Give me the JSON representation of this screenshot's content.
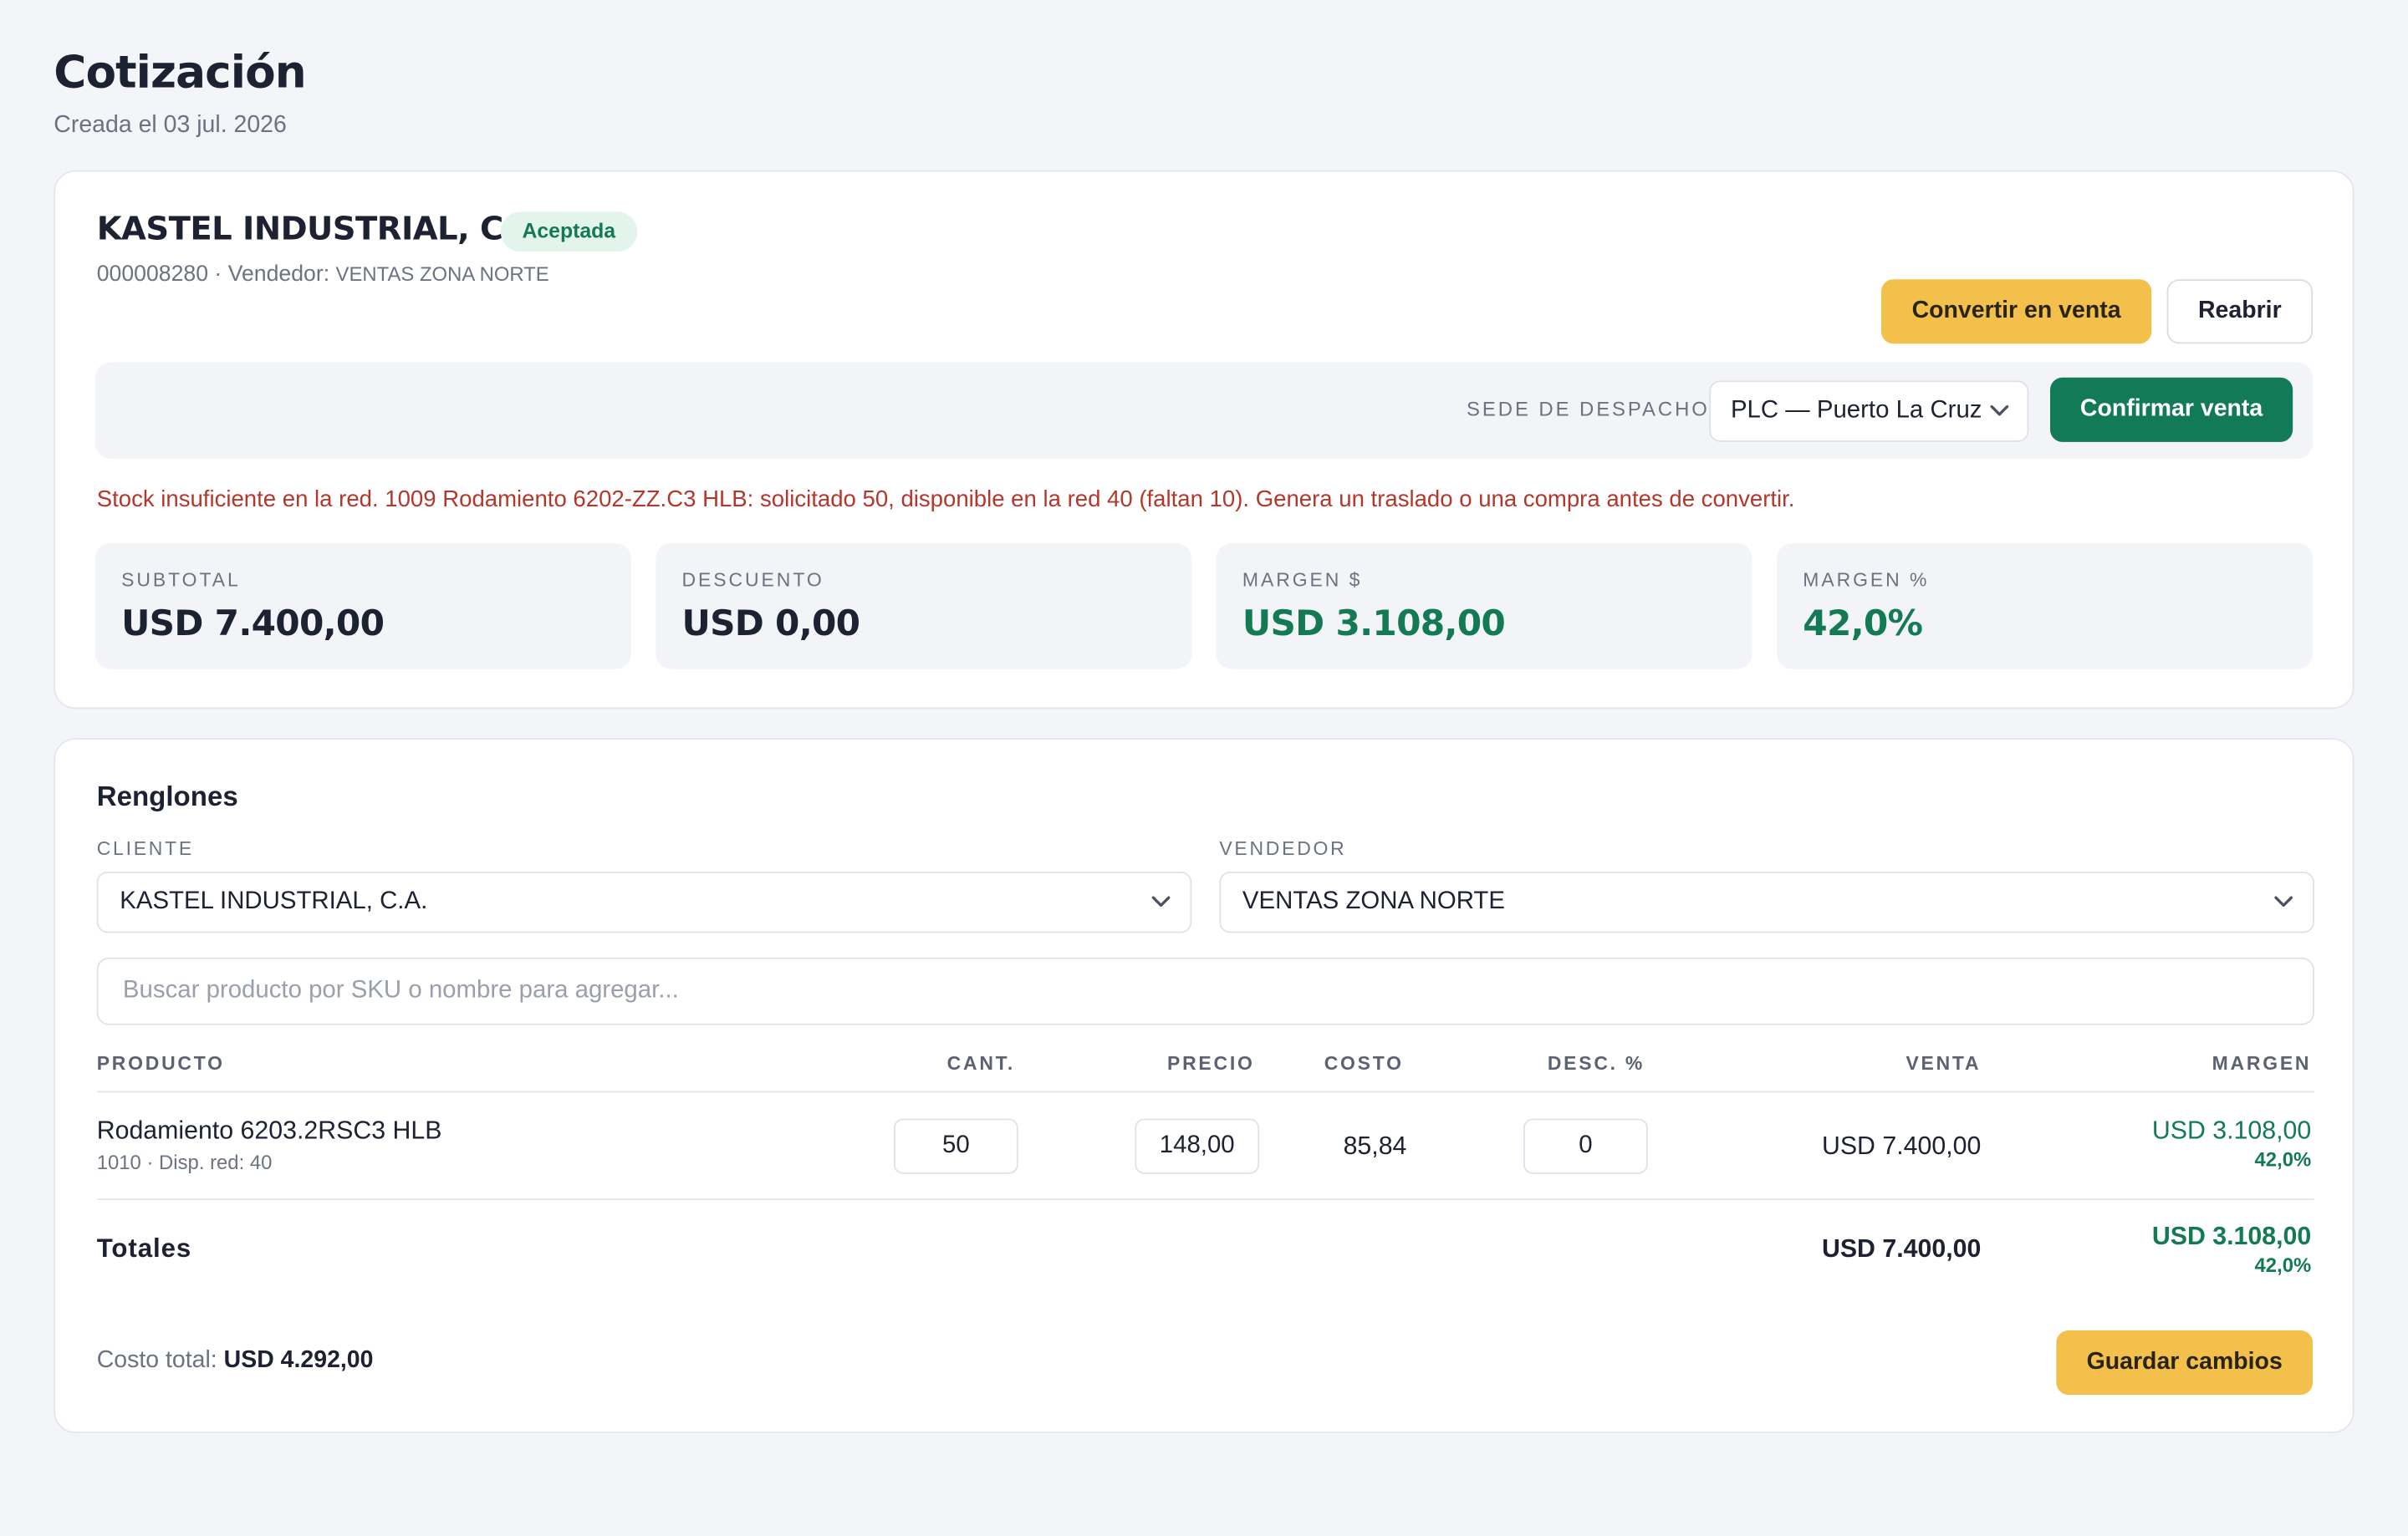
{
  "header": {
    "title": "Cotización",
    "subtitle": "Creada el 03 jul. 2026"
  },
  "quote": {
    "company": "KASTEL INDUSTRIAL, C.A.",
    "status": "Aceptada",
    "number": "000008280",
    "separator": " · ",
    "seller_label": "Vendedor: ",
    "seller": "VENTAS ZONA NORTE",
    "actions": {
      "convert_label": "Convertir en venta",
      "reopen_label": "Reabrir"
    }
  },
  "dispatch": {
    "label": "SEDE DE DESPACHO",
    "selected": "PLC — Puerto La Cruz",
    "confirm_label": "Confirmar venta"
  },
  "warning": "Stock insuficiente en la red. 1009 Rodamiento 6202-ZZ.C3 HLB: solicitado 50, disponible en la red 40 (faltan 10). Genera un traslado o una compra antes de convertir.",
  "stats": [
    {
      "label": "SUBTOTAL",
      "value": "USD 7.400,00"
    },
    {
      "label": "DESCUENTO",
      "value": "USD 0,00"
    },
    {
      "label": "MARGEN $",
      "value": "USD 3.108,00"
    },
    {
      "label": "MARGEN %",
      "value": "42,0%"
    }
  ],
  "lines": {
    "title": "Renglones",
    "client_label": "CLIENTE",
    "client_value": "KASTEL INDUSTRIAL, C.A.",
    "seller_label": "VENDEDOR",
    "seller_value": "VENTAS ZONA NORTE",
    "search_placeholder": "Buscar producto por SKU o nombre para agregar...",
    "columns": {
      "product": "PRODUCTO",
      "qty": "CANT.",
      "price": "PRECIO",
      "cost": "COSTO",
      "discount": "DESC. %",
      "sale": "VENTA",
      "margin": "MARGEN"
    },
    "rows": [
      {
        "product": "Rodamiento 6203.2RSC3 HLB",
        "meta": "1010 · Disp. red: 40",
        "qty": "50",
        "price": "148,00",
        "cost": "85,84",
        "discount": "0",
        "sale": "USD 7.400,00",
        "margin": "USD 3.108,00",
        "margin_pct": "42,0%"
      }
    ],
    "totals": {
      "label": "Totales",
      "sale": "USD 7.400,00",
      "margin": "USD 3.108,00",
      "margin_pct": "42,0%"
    },
    "cost_total_label": "Costo total: ",
    "cost_total_value": "USD 4.292,00",
    "save_label": "Guardar cambios"
  },
  "colors": {
    "accent_yellow": "#f2c04b",
    "accent_green": "#127a56",
    "warning_red": "#b3382b",
    "page_bg": "#f4f5f9"
  },
  "icons": {
    "select_chevron": "chevron-down-icon"
  }
}
